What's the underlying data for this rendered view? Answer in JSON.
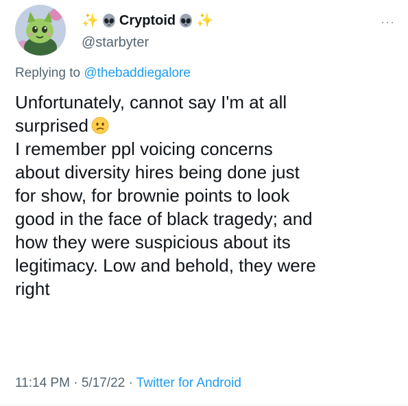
{
  "author": {
    "sparkle_left": "✨",
    "name": "Cryptoid",
    "sparkle_right": "✨",
    "handle": "@starbyter",
    "more_label": "···"
  },
  "reply": {
    "prefix": "Replying to",
    "mention": "@thebaddiegalore"
  },
  "tweet": {
    "lines": [
      "Unfortunately, cannot say I'm at all",
      "surprised",
      "I remember ppl voicing concerns",
      "about diversity hires being done just",
      "for show, for brownie points to look",
      "good in the face of black tragedy; and",
      "how they were suspicious about its",
      "legitimacy. Low and behold, they were",
      "right"
    ]
  },
  "meta": {
    "time": "11:14 PM",
    "sep1": "·",
    "date": "5/17/22",
    "sep2": "·",
    "source": "Twitter for Android"
  },
  "icons": {
    "avatar": "green-cat-character-avatar",
    "alien": "alien-icon",
    "emoji": "confused-face-emoji"
  },
  "colors": {
    "text": "#0f1419",
    "muted": "#536471",
    "link": "#1d9bf0"
  }
}
